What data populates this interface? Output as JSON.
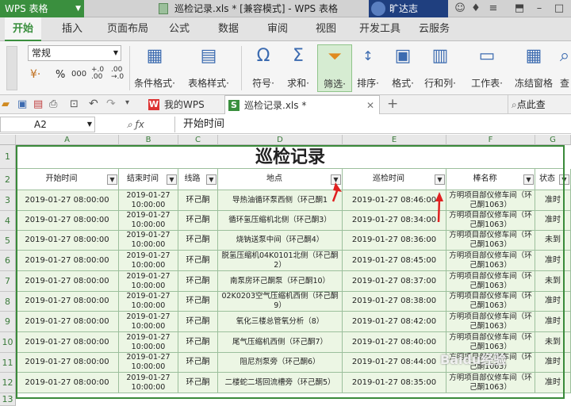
{
  "titlebar": {
    "app_name": "WPS 表格",
    "doc_title": "巡检记录.xls * [兼容模式] - WPS 表格",
    "user": "旷达志"
  },
  "tabs": [
    "开始",
    "插入",
    "页面布局",
    "公式",
    "数据",
    "审阅",
    "视图",
    "开发工具",
    "云服务"
  ],
  "ribbon": {
    "number_format": "常规",
    "buttons": [
      {
        "label": "条件格式·",
        "icon": "conditional-format-icon"
      },
      {
        "label": "表格样式·",
        "icon": "table-style-icon"
      },
      {
        "label": "符号·",
        "icon": "omega-icon",
        "glyph": "Ω"
      },
      {
        "label": "求和·",
        "icon": "sigma-icon",
        "glyph": "Σ"
      },
      {
        "label": "筛选·",
        "icon": "filter-icon"
      },
      {
        "label": "排序·",
        "icon": "sort-icon"
      },
      {
        "label": "格式·",
        "icon": "format-icon"
      },
      {
        "label": "行和列·",
        "icon": "rows-cols-icon"
      },
      {
        "label": "工作表·",
        "icon": "worksheet-icon"
      },
      {
        "label": "冻结窗格",
        "icon": "freeze-icon"
      },
      {
        "label": "查",
        "icon": "find-icon"
      }
    ],
    "percent": "%"
  },
  "doc_tabs": [
    {
      "label": "我的WPS",
      "icon": "W"
    },
    {
      "label": "巡检记录.xls *",
      "icon": "S"
    }
  ],
  "search_hint": "点此查",
  "formula": {
    "name_box": "A2",
    "content": "开始时间"
  },
  "sheet": {
    "columns": [
      "A",
      "B",
      "C",
      "D",
      "E",
      "F",
      "G"
    ],
    "rows": [
      "1",
      "2",
      "3",
      "4",
      "5",
      "6",
      "7",
      "8",
      "9",
      "10",
      "11",
      "12",
      "13"
    ],
    "title": "巡检记录",
    "headers": [
      "开始时间",
      "结束时间",
      "线路",
      "地点",
      "巡检时间",
      "棒名称",
      "状态"
    ],
    "data": [
      [
        "2019-01-27 08:00:00",
        "2019-01-27 10:00:00",
        "环己酮",
        "导热油循环泵西侧（环己酮1",
        "2019-01-27 08:46:00",
        "方明项目部仪修车间（环己酮1063）",
        "准时"
      ],
      [
        "2019-01-27 08:00:00",
        "2019-01-27 10:00:00",
        "环己酮",
        "循环氢压缩机北侧（环己酮3）",
        "2019-01-27 08:34:00",
        "方明项目部仪修车间（环己酮1063）",
        "准时"
      ],
      [
        "2019-01-27 08:00:00",
        "2019-01-27 10:00:00",
        "环己酮",
        "烧钠送泵中间（环己酮4）",
        "2019-01-27 08:36:00",
        "方明项目部仪修车间（环己酮1063）",
        "未到"
      ],
      [
        "2019-01-27 08:00:00",
        "2019-01-27 10:00:00",
        "环己酮",
        "脱氢压缩机04K0101北侧（环己酮2）",
        "2019-01-27 08:45:00",
        "方明项目部仪修车间（环己酮1063）",
        "准时"
      ],
      [
        "2019-01-27 08:00:00",
        "2019-01-27 10:00:00",
        "环己酮",
        "南泵房环己酮泵（环己酮10）",
        "2019-01-27 08:37:00",
        "方明项目部仪修车间（环己酮1063）",
        "未到"
      ],
      [
        "2019-01-27 08:00:00",
        "2019-01-27 10:00:00",
        "环己酮",
        "02K0203空气压缩机西侧（环己酮9）",
        "2019-01-27 08:38:00",
        "方明项目部仪修车间（环己酮1063）",
        "准时"
      ],
      [
        "2019-01-27 08:00:00",
        "2019-01-27 10:00:00",
        "环己酮",
        "氧化三楼总管氧分析（8）",
        "2019-01-27 08:42:00",
        "方明项目部仪修车间（环己酮1063）",
        "准时"
      ],
      [
        "2019-01-27 08:00:00",
        "2019-01-27 10:00:00",
        "环己酮",
        "尾气压缩机西侧（环己酮7）",
        "2019-01-27 08:40:00",
        "方明项目部仪修车间（环己酮1063）",
        "未到"
      ],
      [
        "2019-01-27 08:00:00",
        "2019-01-27 10:00:00",
        "环己酮",
        "阻尼剂泵旁（环己酮6）",
        "2019-01-27 08:44:00",
        "方明项目部仪修车间（环己酮1063）",
        "准时"
      ],
      [
        "2019-01-27 08:00:00",
        "2019-01-27 10:00:00",
        "环己酮",
        "二楼蛇二塔回流槽旁（环己酮5）",
        "2019-01-27 08:35:00",
        "方明项目部仪修车间（环己酮1063）",
        "准时"
      ]
    ]
  },
  "watermark": "Baidu经验",
  "colors": {
    "accent": "#3a8f3e",
    "cell_fill": "#ecf6e4",
    "arrow": "#e02020"
  }
}
